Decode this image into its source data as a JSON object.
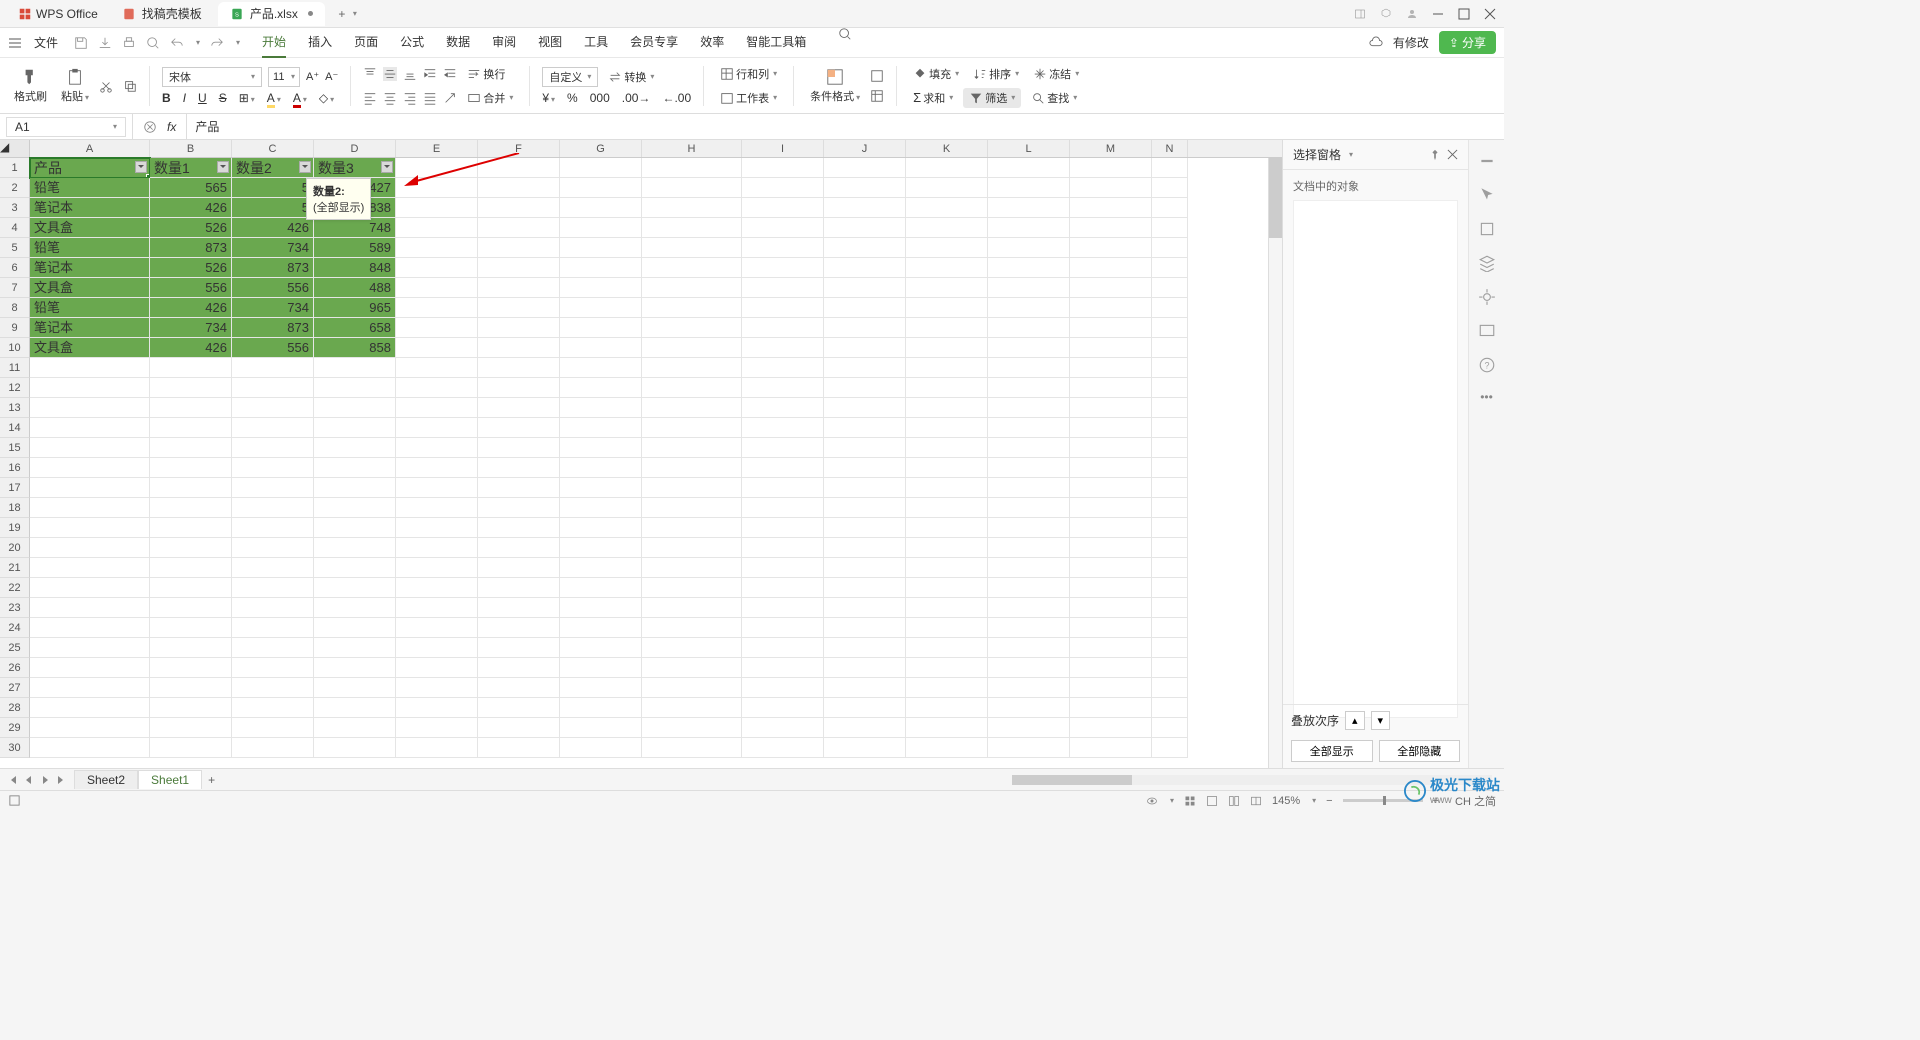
{
  "app": {
    "name": "WPS Office"
  },
  "tabs": [
    {
      "label": "找稿壳模板",
      "active": false
    },
    {
      "label": "产品.xlsx",
      "active": true,
      "dirty": true
    }
  ],
  "menu": {
    "file": "文件",
    "items": [
      "开始",
      "插入",
      "页面",
      "公式",
      "数据",
      "审阅",
      "视图",
      "工具",
      "会员专享",
      "效率",
      "智能工具箱"
    ],
    "active": "开始",
    "changes": "有修改",
    "share": "分享"
  },
  "ribbon": {
    "format_painter": "格式刷",
    "paste": "粘贴",
    "font_name": "宋体",
    "font_size": "11",
    "wrap": "换行",
    "merge": "合并",
    "number_format": "自定义",
    "convert": "转换",
    "rowcol": "行和列",
    "worksheet": "工作表",
    "cond_format": "条件格式",
    "fill": "填充",
    "sort": "排序",
    "freeze": "冻结",
    "sum": "求和",
    "filter": "筛选",
    "find": "查找"
  },
  "cell_ref": {
    "name": "A1",
    "formula": "产品"
  },
  "columns": [
    "A",
    "B",
    "C",
    "D",
    "E",
    "F",
    "G",
    "H",
    "I",
    "J",
    "K",
    "L",
    "M",
    "N"
  ],
  "header_row": [
    "产品",
    "数量1",
    "数量2",
    "数量3"
  ],
  "data_rows": [
    [
      "铅笔",
      "565",
      "5",
      "427"
    ],
    [
      "笔记本",
      "426",
      "5",
      "838"
    ],
    [
      "文具盒",
      "526",
      "426",
      "748"
    ],
    [
      "铅笔",
      "873",
      "734",
      "589"
    ],
    [
      "笔记本",
      "526",
      "873",
      "848"
    ],
    [
      "文具盒",
      "556",
      "556",
      "488"
    ],
    [
      "铅笔",
      "426",
      "734",
      "965"
    ],
    [
      "笔记本",
      "734",
      "873",
      "658"
    ],
    [
      "文具盒",
      "426",
      "556",
      "858"
    ]
  ],
  "tooltip": {
    "title": "数量2:",
    "body": "(全部显示)"
  },
  "sheets": {
    "list": [
      "Sheet2",
      "Sheet1"
    ],
    "active": "Sheet1"
  },
  "side": {
    "title": "选择窗格",
    "doc_objects": "文档中的对象",
    "stack_order": "叠放次序",
    "show_all": "全部显示",
    "hide_all": "全部隐藏"
  },
  "status": {
    "zoom": "145%",
    "ime": "CH 之简"
  },
  "watermark": {
    "brand": "极光下载站",
    "url": "www"
  }
}
